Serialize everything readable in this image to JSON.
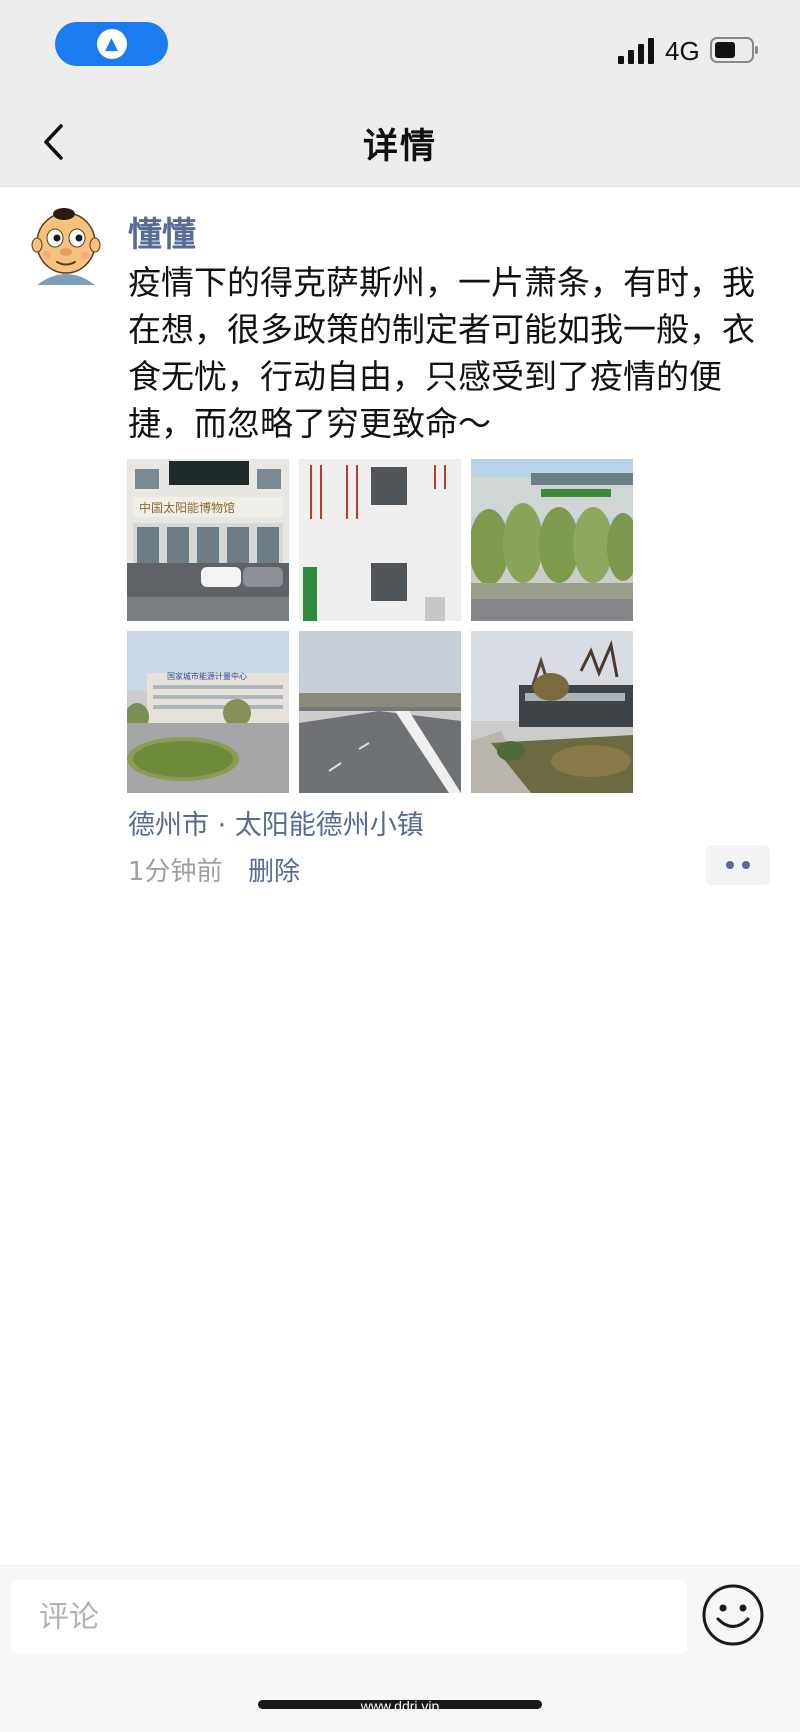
{
  "status_bar": {
    "network": "4G",
    "nav_icon": "navigation-arrow-icon",
    "signal_icon": "cellular-signal-icon",
    "battery_icon": "battery-icon",
    "accent_color": "#1c7cf2"
  },
  "header": {
    "title": "详情",
    "back_icon": "chevron-left-icon"
  },
  "post": {
    "author": "懂懂",
    "text": "疫情下的得克萨斯州，一片萧条，有时，我在想，很多政策的制定者可能如我一般，衣食无忧，行动自由，只感受到了疫情的便捷，而忽略了穷更致命～",
    "photos": [
      {
        "icon": "museum-building-photo"
      },
      {
        "icon": "white-wall-slogans-photo"
      },
      {
        "icon": "roadside-trees-photo"
      },
      {
        "icon": "government-building-photo"
      },
      {
        "icon": "empty-road-photo"
      },
      {
        "icon": "sidewalk-trees-photo"
      }
    ],
    "location": "德州市 · 太阳能德州小镇",
    "time": "1分钟前",
    "delete_label": "删除",
    "more_icon": "more-dots-icon",
    "link_color": "#576b95"
  },
  "comment": {
    "placeholder": "评论",
    "emoji_icon": "smiley-face-icon"
  },
  "watermark": "www.ddrj.vip"
}
